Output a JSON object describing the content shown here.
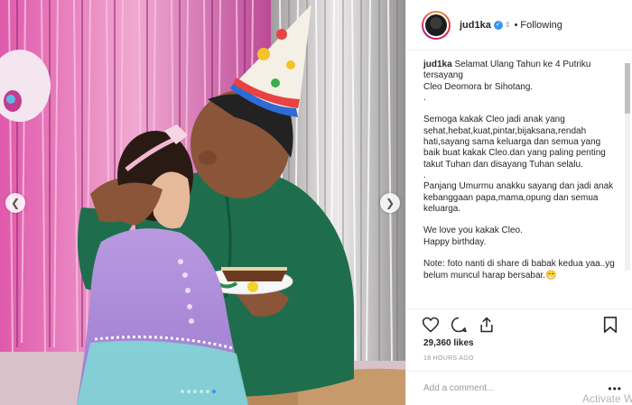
{
  "post": {
    "photo_alt": "Birthday photo",
    "nav_left_icon": "chevron-left-icon",
    "nav_right_icon": "chevron-right-icon",
    "carousel": {
      "count": 6,
      "active_index": 5
    }
  },
  "header": {
    "username": "jud1ka",
    "verified_icon": "verified-badge-icon",
    "separator": "•",
    "follow_status": "Following"
  },
  "caption": {
    "author": "jud1ka",
    "text": " Selamat Ulang Tahun ke 4 Putriku tersayang\nCleo Deomora br Sihotang.\n.\n\nSemoga kakak Cleo jadi anak yang sehat,hebat,kuat,pintar,bijaksana,rendah hati,sayang sama keluarga dan semua yang baik buat kakak Cleo.dan yang paling penting takut Tuhan dan disayang Tuhan selalu.\n.\nPanjang Umurmu anakku sayang dan jadi anak kebanggaan papa,mama,opung dan semua keluarga.\n\nWe love you kakak Cleo.\nHappy birthday.\n\nNote: foto nanti di share di babak kedua yaa..yg belum muncul harap bersabar.😁"
  },
  "actions": {
    "icons": [
      "heart-icon",
      "comment-icon",
      "share-icon",
      "bookmark-icon"
    ]
  },
  "likes": "29,360 likes",
  "timestamp": "18 HOURS AGO",
  "comment": {
    "placeholder": "Add a comment...",
    "more": "•••"
  },
  "overlay": {
    "watermark": "Activate W"
  },
  "colors": {
    "accent": "#3897f0",
    "text": "#262626",
    "muted": "#999999",
    "border": "#efefef"
  }
}
